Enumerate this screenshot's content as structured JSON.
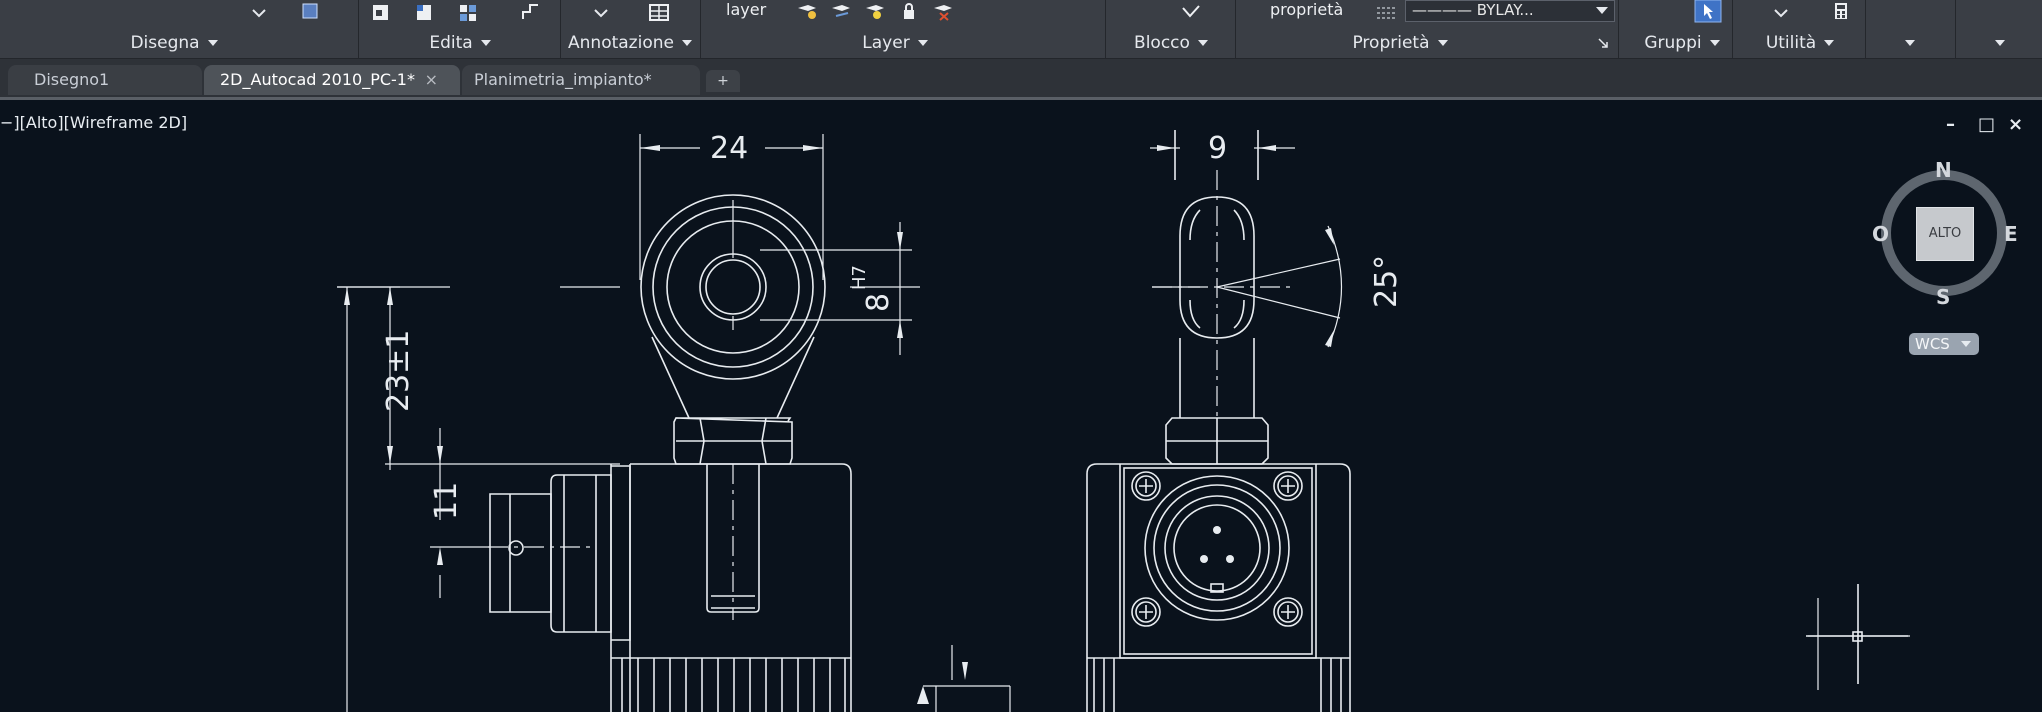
{
  "ribbon": {
    "panels": [
      {
        "label": "Disegna"
      },
      {
        "label": "Edita"
      },
      {
        "label": "Annotazione"
      },
      {
        "label": "Layer"
      },
      {
        "label": "Blocco"
      },
      {
        "label": "Proprietà"
      },
      {
        "label": "Gruppi"
      },
      {
        "label": "Utilità"
      }
    ],
    "layer_button_text": "layer",
    "properties_button_text": "proprietà",
    "linetype_value": "———— BYLAY..."
  },
  "tabs": [
    {
      "label": "Disegno1"
    },
    {
      "label": "2D_Autocad 2010_PC-1*",
      "close": "×"
    },
    {
      "label": "Planimetria_impianto*"
    }
  ],
  "new_tab_label": "+",
  "viewport": {
    "label": "−][Alto][Wireframe 2D]",
    "controls": [
      "–",
      "□",
      "×"
    ]
  },
  "viewcube": {
    "north": "N",
    "south": "S",
    "east": "E",
    "west": "O",
    "face": "ALTO",
    "wcs": "WCS"
  },
  "drawing": {
    "dim_width": "24",
    "dim_thread": "9",
    "dim_bore": "8",
    "dim_bore_tol": "H7",
    "dim_angle": "25°",
    "dim_height": "23±1",
    "dim_offset": "11"
  },
  "colors": {
    "canvas": "#0a121c",
    "ribbon": "#3a3e45",
    "lines": "#e8ecf0"
  }
}
